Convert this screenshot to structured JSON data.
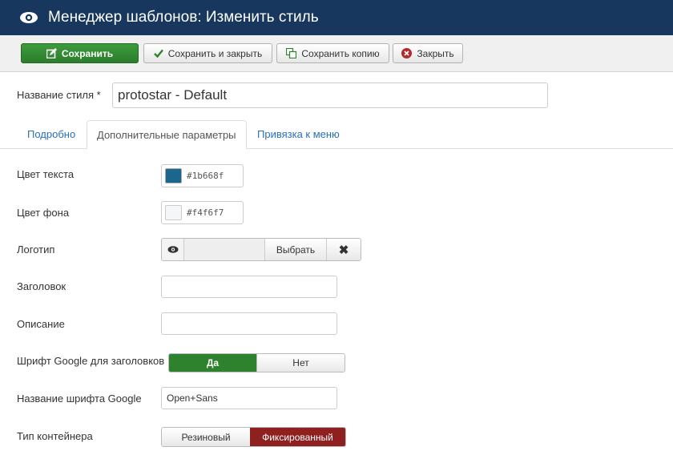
{
  "header": {
    "title": "Менеджер шаблонов: Изменить стиль",
    "icon": "eye-icon"
  },
  "toolbar": {
    "save_label": "Сохранить",
    "save_close_label": "Сохранить и закрыть",
    "save_copy_label": "Сохранить копию",
    "close_label": "Закрыть"
  },
  "style_name": {
    "label": "Название стиля *",
    "value": "protostar - Default"
  },
  "tabs": [
    {
      "label": "Подробно",
      "active": false
    },
    {
      "label": "Дополнительные параметры",
      "active": true
    },
    {
      "label": "Привязка к меню",
      "active": false
    }
  ],
  "params": {
    "text_color": {
      "label": "Цвет текста",
      "value": "#1b668f"
    },
    "bg_color": {
      "label": "Цвет фона",
      "value": "#f4f6f7"
    },
    "logo": {
      "label": "Логотип",
      "select_label": "Выбрать",
      "clear_symbol": "✖"
    },
    "heading": {
      "label": "Заголовок",
      "value": ""
    },
    "description": {
      "label": "Описание",
      "value": ""
    },
    "google_font": {
      "label": "Шрифт Google для заголовков",
      "yes": "Да",
      "no": "Нет",
      "selected": "yes"
    },
    "google_font_name": {
      "label": "Название шрифта Google",
      "value": "Open+Sans"
    },
    "container": {
      "label": "Тип контейнера",
      "fluid": "Резиновый",
      "static": "Фиксированный",
      "selected": "static"
    }
  },
  "colors": {
    "header_bg": "#17375e",
    "save_green": "#2e822e",
    "active_red": "#8e2020",
    "link_blue": "#2a70b8"
  }
}
